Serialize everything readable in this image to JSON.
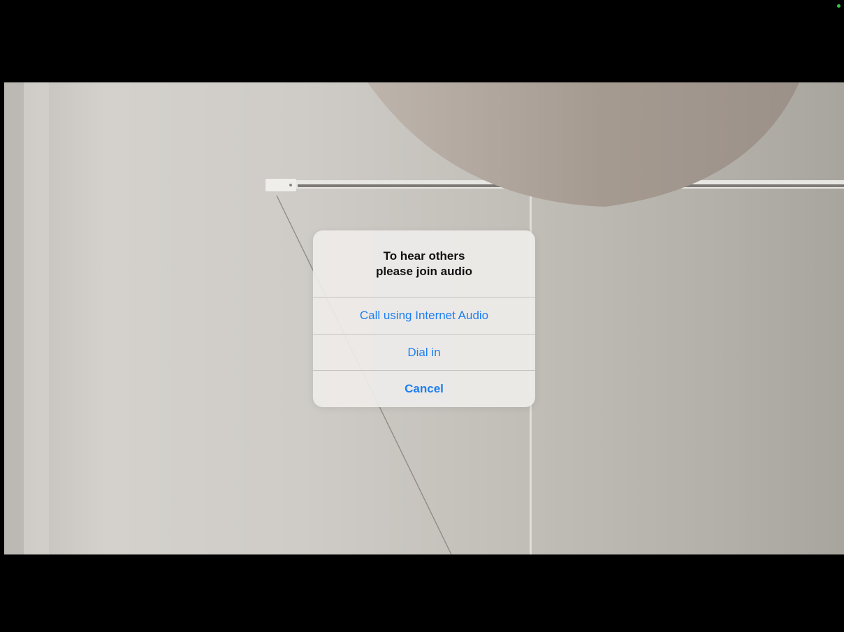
{
  "dialog": {
    "title_line1": "To hear others",
    "title_line2": "please join audio",
    "buttons": [
      {
        "label": "Call using Internet Audio"
      },
      {
        "label": "Dial in"
      },
      {
        "label": "Cancel"
      }
    ]
  },
  "colors": {
    "accent": "#1d7ef0",
    "status_dot": "#36c24a",
    "letterbox": "#000000"
  }
}
